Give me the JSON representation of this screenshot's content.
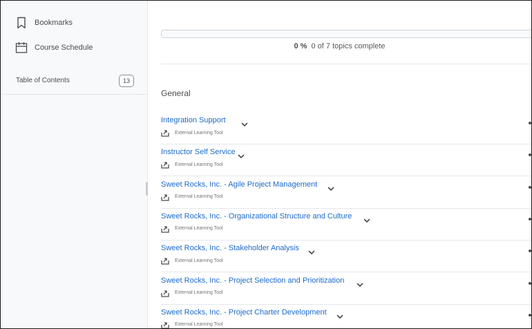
{
  "sidebar": {
    "bookmarks_label": "Bookmarks",
    "schedule_label": "Course Schedule",
    "toc_label": "Table of Contents",
    "toc_count": "13"
  },
  "progress": {
    "percent_label": "0 %",
    "summary": "0 of 7 topics complete",
    "fraction": 0
  },
  "module": {
    "title": "General",
    "topics": [
      {
        "title": "Integration Support",
        "type": "External Learning Tool"
      },
      {
        "title": "Instructor Self Service",
        "type": "External Learning Tool"
      },
      {
        "title": "Sweet Rocks, Inc. - Agile Project Management",
        "type": "External Learning Tool"
      },
      {
        "title": "Sweet Rocks, Inc. - Organizational Structure and Culture",
        "type": "External Learning Tool"
      },
      {
        "title": "Sweet Rocks, Inc. - Stakeholder Analysis",
        "type": "External Learning Tool"
      },
      {
        "title": "Sweet Rocks, Inc. - Project Selection and Prioritization",
        "type": "External Learning Tool"
      },
      {
        "title": "Sweet Rocks, Inc. - Project Charter Development",
        "type": "External Learning Tool"
      }
    ]
  },
  "colors": {
    "link": "#1b6ac9",
    "text": "#494c4e",
    "sidebar_bg": "#f8f9fa"
  }
}
